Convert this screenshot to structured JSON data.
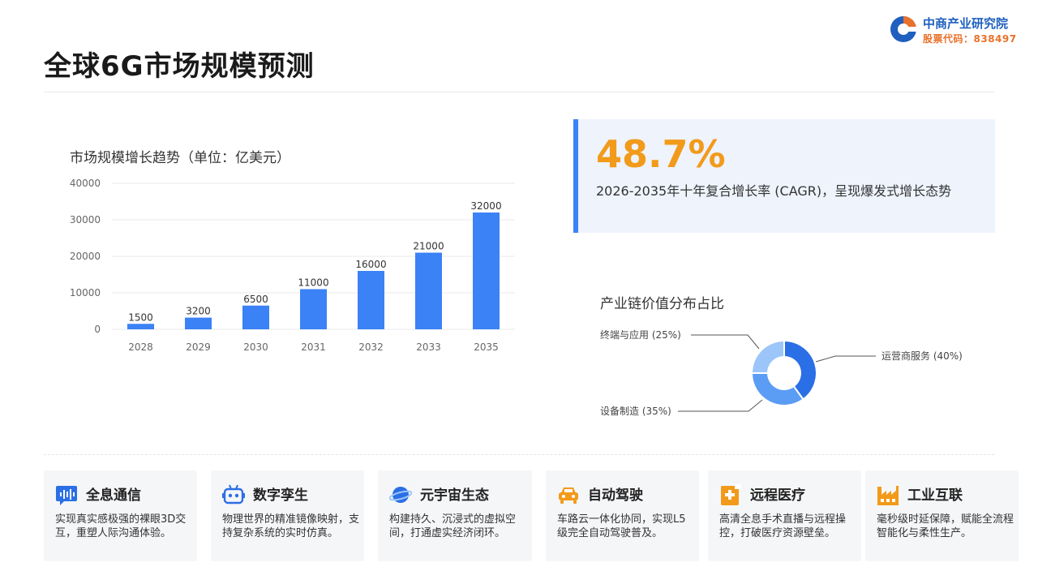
{
  "header": {
    "title": "全球6G市场规模预测",
    "logo_name": "中商产业研究院",
    "logo_code": "股票代码：838497"
  },
  "colors": {
    "accent": "#3b82f6",
    "highlight": "#f29a1a",
    "donut": [
      "#2b6fe6",
      "#5b9cf5",
      "#9cc6f9"
    ]
  },
  "bar_title": "市场规模增长趋势（单位：亿美元）",
  "cagr": {
    "value": "48.7%",
    "description": "2026-2035年十年复合增长率 (CAGR)，呈现爆发式增长态势"
  },
  "donut_title": "产业链价值分布占比",
  "chart_data": [
    {
      "type": "bar",
      "categories": [
        "2028",
        "2029",
        "2030",
        "2031",
        "2032",
        "2033",
        "2035"
      ],
      "values": [
        1500,
        3200,
        6500,
        11000,
        16000,
        21000,
        32000
      ],
      "title": "市场规模增长趋势（单位：亿美元）",
      "ylim": [
        0,
        40000
      ],
      "yticks": [
        0,
        10000,
        20000,
        30000,
        40000
      ],
      "grid": true,
      "data_labels": true
    },
    {
      "type": "pie",
      "donut": true,
      "title": "产业链价值分布占比",
      "labels": [
        "运营商服务 (40%)",
        "设备制造 (35%)",
        "终端与应用 (25%)"
      ],
      "values": [
        40,
        35,
        25
      ]
    }
  ],
  "cards": [
    {
      "icon": "voice-wave-icon",
      "title": "全息通信",
      "desc": "实现真实感极强的裸眼3D交互，重塑人际沟通体验。"
    },
    {
      "icon": "robot-icon",
      "title": "数字孪生",
      "desc": "物理世界的精准镜像映射，支持复杂系统的实时仿真。"
    },
    {
      "icon": "planet-icon",
      "title": "元宇宙生态",
      "desc": "构建持久、沉浸式的虚拟空间，打通虚实经济闭环。"
    },
    {
      "icon": "car-icon",
      "title": "自动驾驶",
      "desc": "车路云一体化协同，实现L5级完全自动驾驶普及。"
    },
    {
      "icon": "medical-icon",
      "title": "远程医疗",
      "desc": "高清全息手术直播与远程操控，打破医疗资源壁垒。"
    },
    {
      "icon": "factory-icon",
      "title": "工业互联",
      "desc": "毫秒级时延保障，赋能全流程智能化与柔性生产。"
    }
  ]
}
